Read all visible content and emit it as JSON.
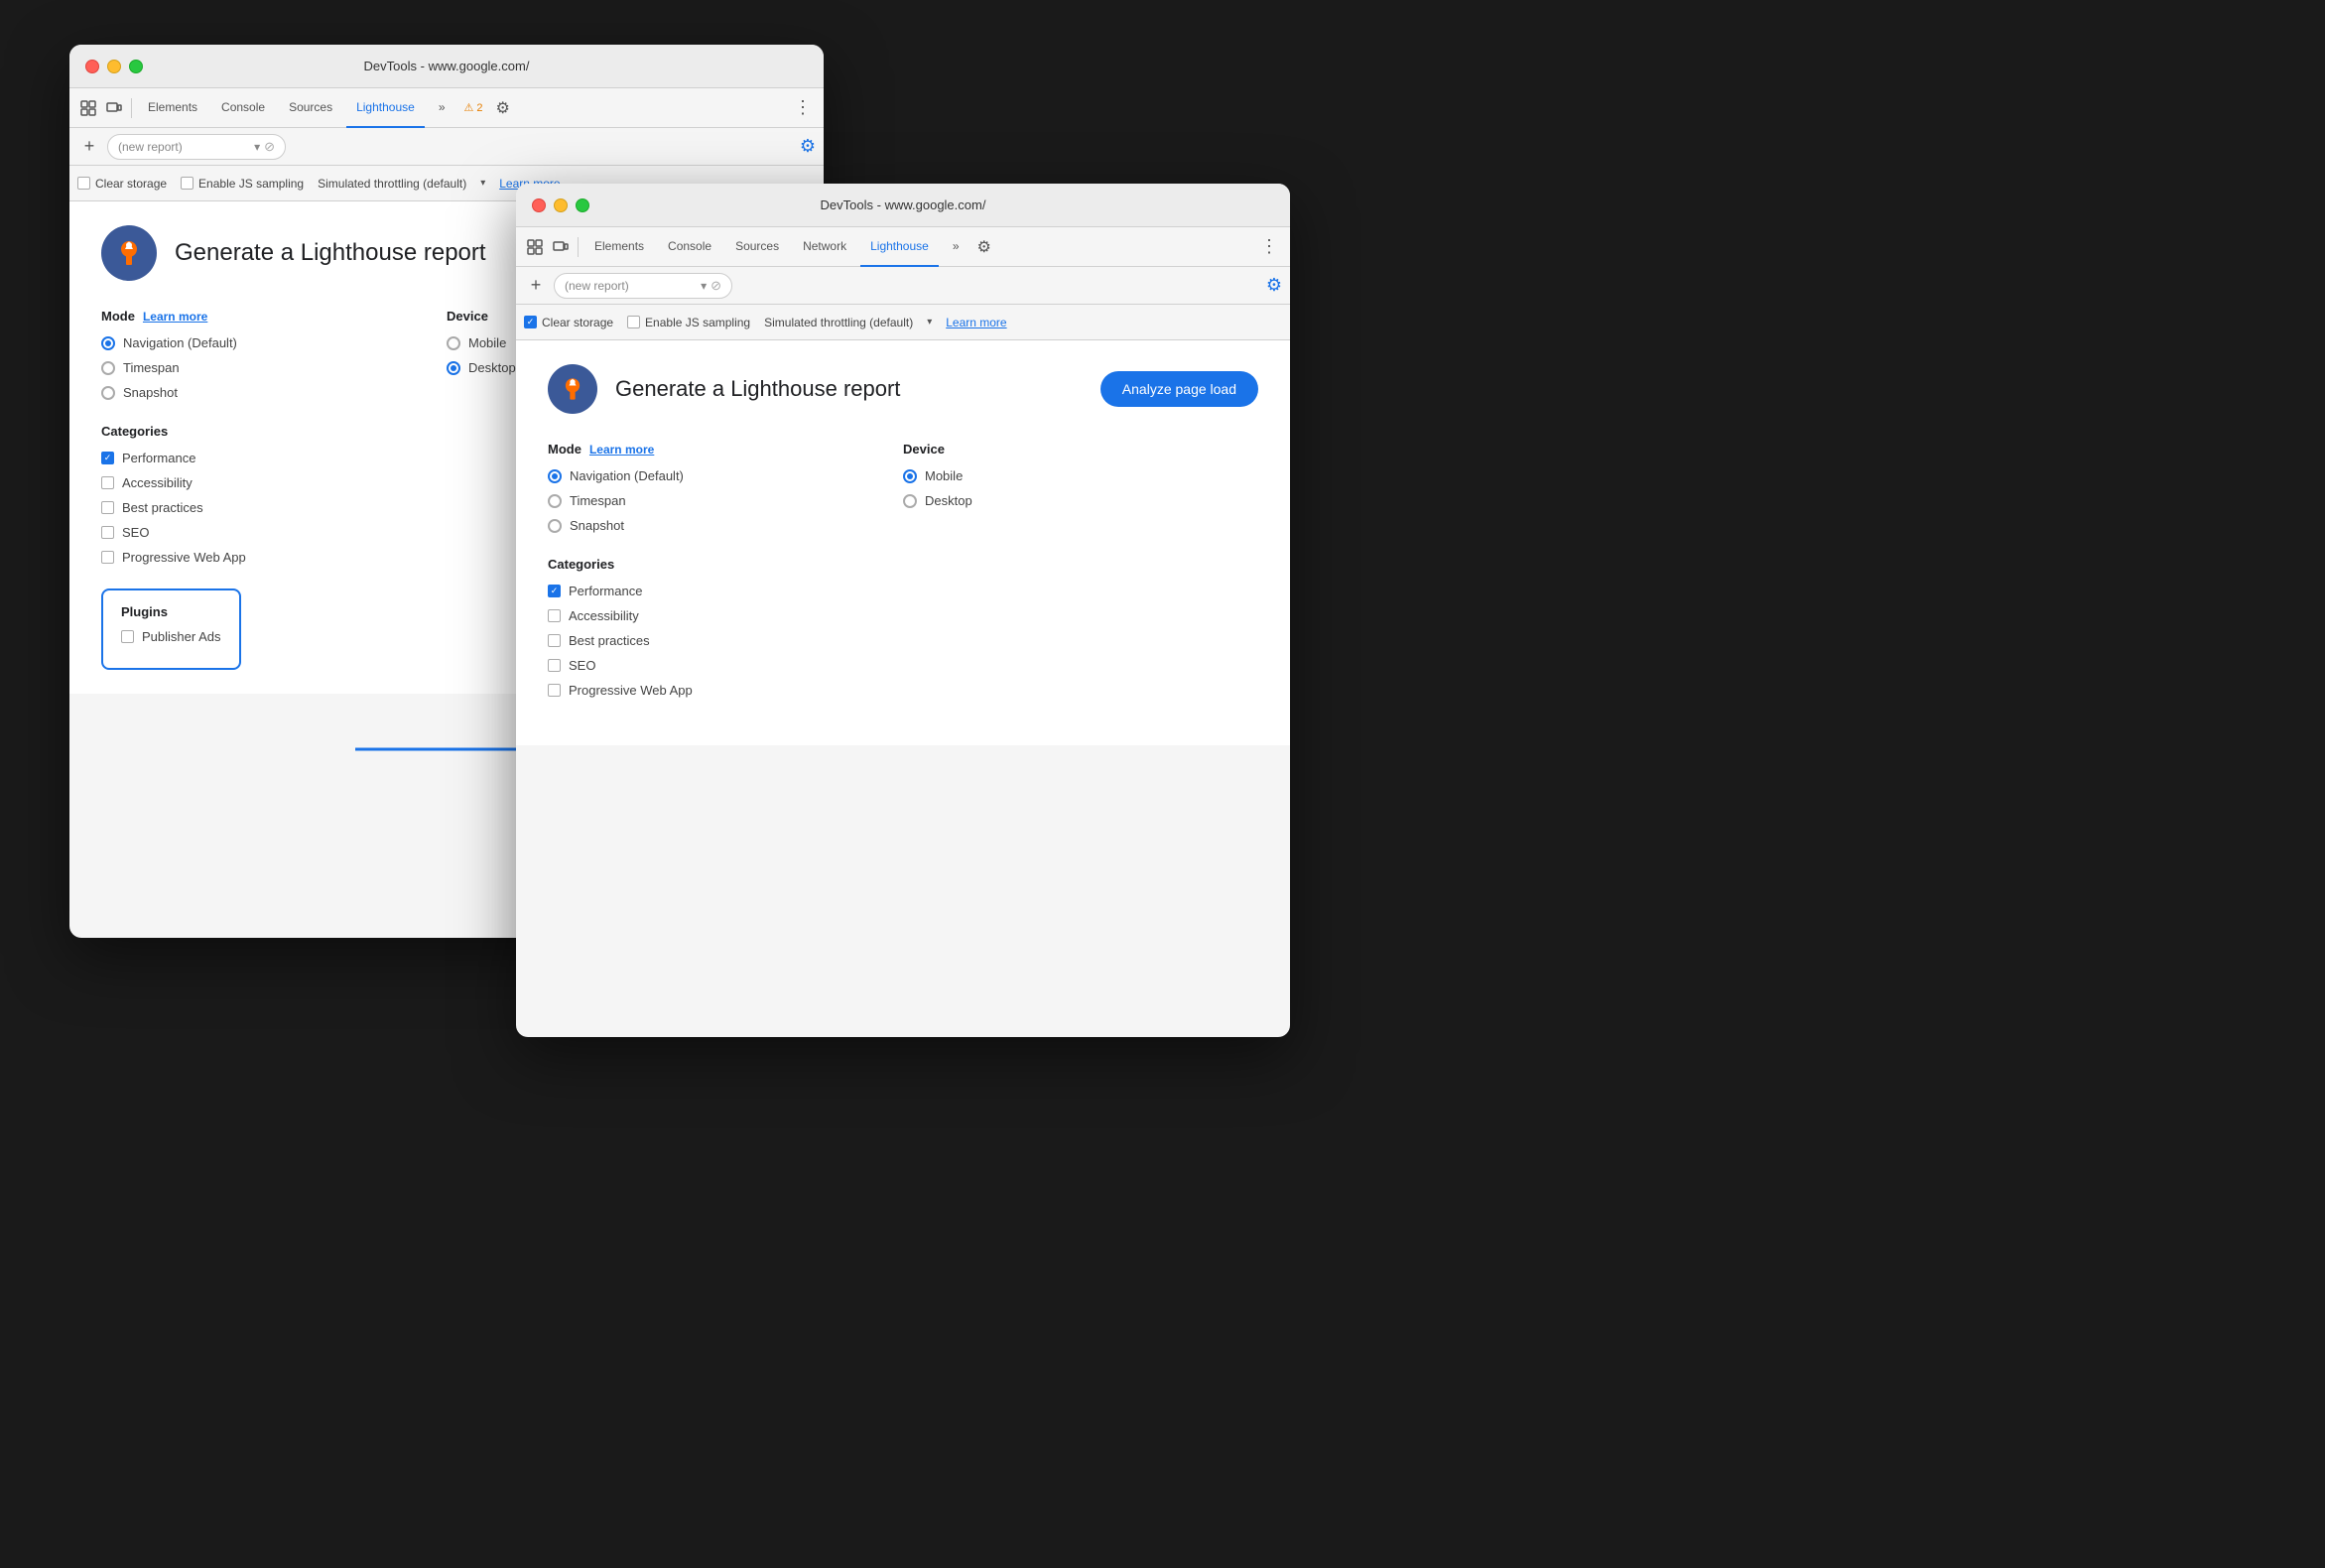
{
  "window1": {
    "title": "DevTools - www.google.com/",
    "tabs": [
      {
        "label": "Elements",
        "active": false
      },
      {
        "label": "Console",
        "active": false
      },
      {
        "label": "Sources",
        "active": false
      },
      {
        "label": "Lighthouse",
        "active": true
      },
      {
        "label": "»",
        "active": false
      }
    ],
    "warning": "⚠ 2",
    "url_field": "(new report)",
    "clear_storage_label": "Clear storage",
    "clear_storage_checked": false,
    "js_sampling_label": "Enable JS sampling",
    "js_sampling_checked": false,
    "throttling_label": "Simulated throttling (default)",
    "learn_more": "Learn more",
    "report_title": "Generate a Lighthouse report",
    "mode_label": "Mode",
    "mode_learn_more": "Learn more",
    "device_label": "Device",
    "modes": [
      {
        "label": "Navigation (Default)",
        "selected": true
      },
      {
        "label": "Timespan",
        "selected": false
      },
      {
        "label": "Snapshot",
        "selected": false
      }
    ],
    "devices": [
      {
        "label": "Mobile",
        "selected": false
      },
      {
        "label": "Desktop",
        "selected": true
      }
    ],
    "categories_title": "Categories",
    "categories": [
      {
        "label": "Performance",
        "checked": true
      },
      {
        "label": "Accessibility",
        "checked": false
      },
      {
        "label": "Best practices",
        "checked": false
      },
      {
        "label": "SEO",
        "checked": false
      },
      {
        "label": "Progressive Web App",
        "checked": false
      }
    ],
    "plugins_title": "Plugins",
    "plugins": [
      {
        "label": "Publisher Ads",
        "checked": false
      }
    ]
  },
  "window2": {
    "title": "DevTools - www.google.com/",
    "tabs": [
      {
        "label": "Elements",
        "active": false
      },
      {
        "label": "Console",
        "active": false
      },
      {
        "label": "Sources",
        "active": false
      },
      {
        "label": "Network",
        "active": false
      },
      {
        "label": "Lighthouse",
        "active": true
      },
      {
        "label": "»",
        "active": false
      }
    ],
    "url_field": "(new report)",
    "clear_storage_label": "Clear storage",
    "clear_storage_checked": true,
    "js_sampling_label": "Enable JS sampling",
    "js_sampling_checked": false,
    "throttling_label": "Simulated throttling (default)",
    "learn_more": "Learn more",
    "analyze_btn": "Analyze page load",
    "report_title": "Generate a Lighthouse report",
    "mode_label": "Mode",
    "mode_learn_more": "Learn more",
    "device_label": "Device",
    "modes": [
      {
        "label": "Navigation (Default)",
        "selected": true
      },
      {
        "label": "Timespan",
        "selected": false
      },
      {
        "label": "Snapshot",
        "selected": false
      }
    ],
    "devices": [
      {
        "label": "Mobile",
        "selected": true
      },
      {
        "label": "Desktop",
        "selected": false
      }
    ],
    "categories_title": "Categories",
    "categories": [
      {
        "label": "Performance",
        "checked": true
      },
      {
        "label": "Accessibility",
        "checked": false
      },
      {
        "label": "Best practices",
        "checked": false
      },
      {
        "label": "SEO",
        "checked": false
      },
      {
        "label": "Progressive Web App",
        "checked": false
      }
    ]
  },
  "icons": {
    "inspector": "⬚",
    "responsive": "⬜",
    "gear": "⚙",
    "dots": "⋮",
    "plus": "+",
    "clear": "⊘",
    "chevron_down": "▾",
    "check": "✓"
  }
}
